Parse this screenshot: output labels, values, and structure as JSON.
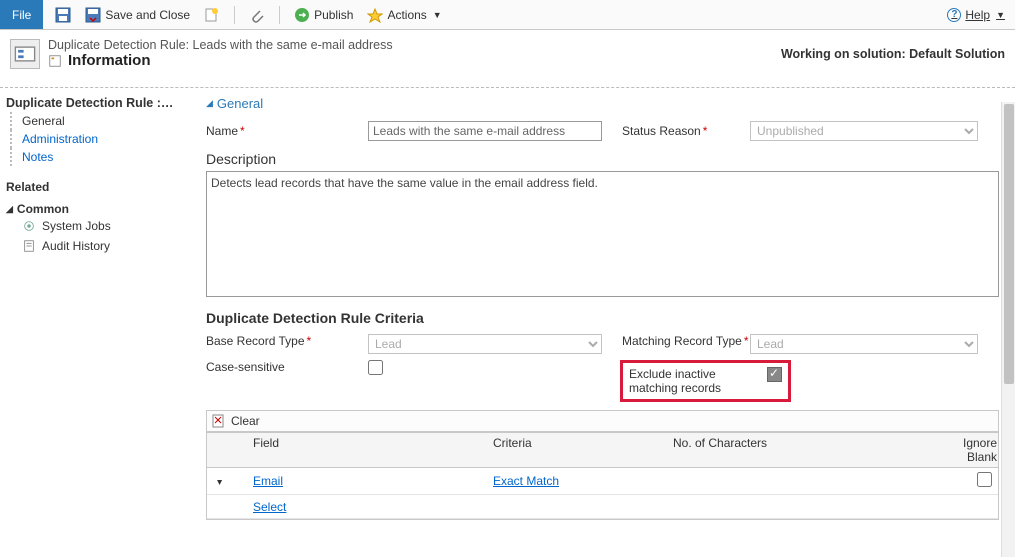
{
  "toolbar": {
    "file": "File",
    "save_close": "Save and Close",
    "publish": "Publish",
    "actions": "Actions",
    "help": "Help"
  },
  "header": {
    "type_line": "Duplicate Detection Rule: Leads with the same e-mail address",
    "title": "Information",
    "solution_text": "Working on solution: Default Solution"
  },
  "leftnav": {
    "crumb": "Duplicate Detection Rule :…",
    "items": [
      "General",
      "Administration",
      "Notes"
    ],
    "related": "Related",
    "common": "Common",
    "sysjobs": "System Jobs",
    "audit": "Audit History"
  },
  "form": {
    "general": "General",
    "name_label": "Name",
    "name_value": "Leads with the same e-mail address",
    "status_label": "Status Reason",
    "status_value": "Unpublished",
    "description_label": "Description",
    "description_value": "Detects lead records that have the same value in the email address field.",
    "criteria_header": "Duplicate Detection Rule Criteria",
    "base_type_label": "Base Record Type",
    "base_type_value": "Lead",
    "match_type_label": "Matching Record Type",
    "match_type_value": "Lead",
    "case_label": "Case-sensitive",
    "exclude_label": "Exclude inactive matching records"
  },
  "grid": {
    "clear": "Clear",
    "col_field": "Field",
    "col_criteria": "Criteria",
    "col_chars": "No. of Characters",
    "col_ignore": "Ignore Blank",
    "row1_field": "Email",
    "row1_criteria": "Exact Match",
    "row2_field": "Select"
  }
}
